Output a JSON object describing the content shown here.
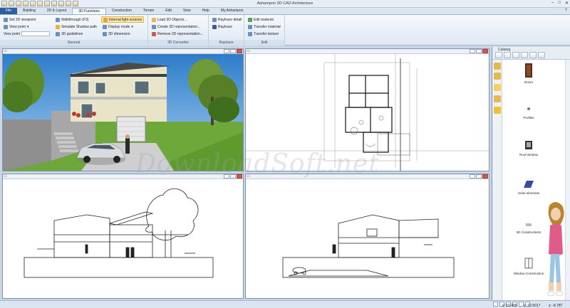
{
  "window": {
    "title": "Ashampoo 3D CAD Architecture",
    "controls": [
      "–",
      "□",
      "✕"
    ]
  },
  "tabs": [
    {
      "label": "File",
      "state": "file"
    },
    {
      "label": "Building",
      "state": ""
    },
    {
      "label": "2D & Layout",
      "state": ""
    },
    {
      "label": "3D Functions",
      "state": "active"
    },
    {
      "label": "Construction",
      "state": ""
    },
    {
      "label": "Terrain",
      "state": ""
    },
    {
      "label": "Edit",
      "state": ""
    },
    {
      "label": "View",
      "state": ""
    },
    {
      "label": "Help",
      "state": ""
    },
    {
      "label": "My Ashampoo",
      "state": ""
    }
  ],
  "ribbon": {
    "general": {
      "label": "General",
      "col1": [
        "Set 3D viewpoint",
        "View point",
        "View point"
      ],
      "col2": [
        "Walkthrough (F3)",
        "Simulate Shadow path",
        "3D guidelines"
      ],
      "col3": [
        "Internal light sources",
        "Display mode",
        "3D dimension"
      ]
    },
    "converter": {
      "label": "3D Converter",
      "col1": [
        "Load 3D Objects...",
        "Create 2D representation...",
        "Remove 2D representation..."
      ]
    },
    "raytrace": {
      "label": "Raytrace",
      "col1": [
        "Raytrace detail",
        "Raytrace"
      ]
    },
    "edit": {
      "label": "Edit",
      "col1": [
        "Edit material",
        "Transfer material",
        "Transfer texture"
      ]
    }
  },
  "catalog": {
    "title": "Catalog",
    "items": [
      {
        "label": "Doors"
      },
      {
        "label": "Profiles"
      },
      {
        "label": "Roof window"
      },
      {
        "label": "Solar elements"
      },
      {
        "label": "3D Constructions"
      },
      {
        "label": "Window Construction"
      }
    ]
  },
  "status": {
    "x": "x: 10.405",
    "y": "y: 19.5017",
    "z": "z: -8.787"
  },
  "colors": {
    "accent": "#2f5f9e",
    "highlight": "#ffe7a8",
    "sky": "#4a8fd1",
    "grass": "#6fa83a"
  }
}
